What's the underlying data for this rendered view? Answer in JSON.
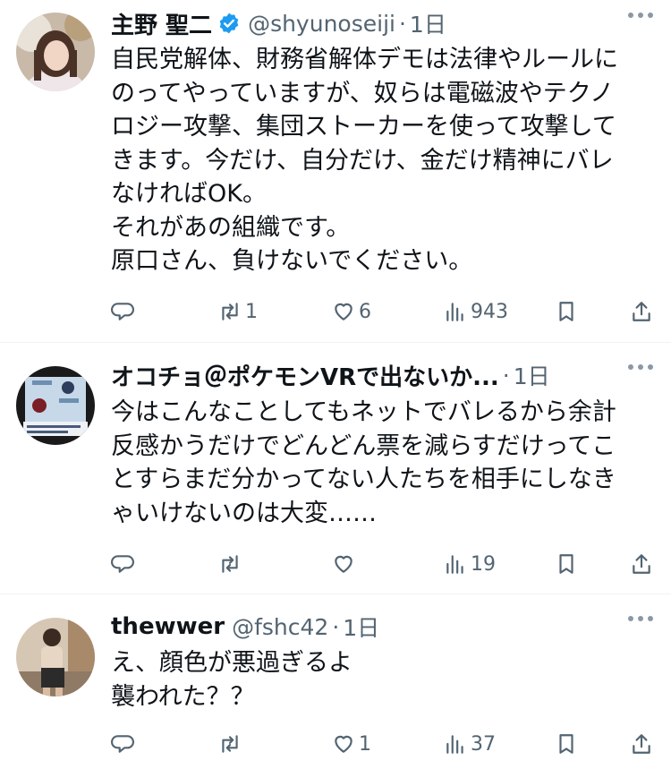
{
  "tweets": [
    {
      "name": "主野 聖二",
      "verified": true,
      "handle": "@shyunoseiji",
      "time": "1日",
      "lines": [
        "自民党解体、財務省解体デモは法律やルールに",
        "のってやっていますが、奴らは電磁波やテクノ",
        "ロジー攻撃、集団ストーカーを使って攻撃して",
        "きます。今だけ、自分だけ、金だけ精神にバレ",
        "なければOK。",
        "それがあの組織です。",
        "原口さん、負けないでください。"
      ],
      "reply_count": "",
      "retweet_count": "1",
      "like_count": "6",
      "views_count": "943"
    },
    {
      "name": "オコチョ＠ポケモンVRで出ないか...",
      "verified": false,
      "handle": "",
      "time": "1日",
      "lines": [
        "今はこんなことしてもネットでバレるから余計",
        "反感かうだけでどんどん票を減らすだけってこ",
        "とすらまだ分かってない人たちを相手にしなき",
        "ゃいけないのは大変……"
      ],
      "reply_count": "",
      "retweet_count": "",
      "like_count": "",
      "views_count": "19"
    },
    {
      "name": "thewwer",
      "verified": false,
      "handle": "@fshc42",
      "time": "1日",
      "lines": [
        "え、顔色が悪過ぎるよ",
        "襲われた？？"
      ],
      "reply_count": "",
      "retweet_count": "",
      "like_count": "1",
      "views_count": "37"
    }
  ],
  "colors": {
    "text": "#0f1419",
    "secondary": "#536471",
    "verified": "#1d9bf0",
    "divider": "#eff3f4"
  },
  "icons": [
    "reply-icon",
    "retweet-icon",
    "like-icon",
    "views-icon",
    "bookmark-icon",
    "share-icon",
    "verified-badge-icon",
    "more-icon"
  ]
}
